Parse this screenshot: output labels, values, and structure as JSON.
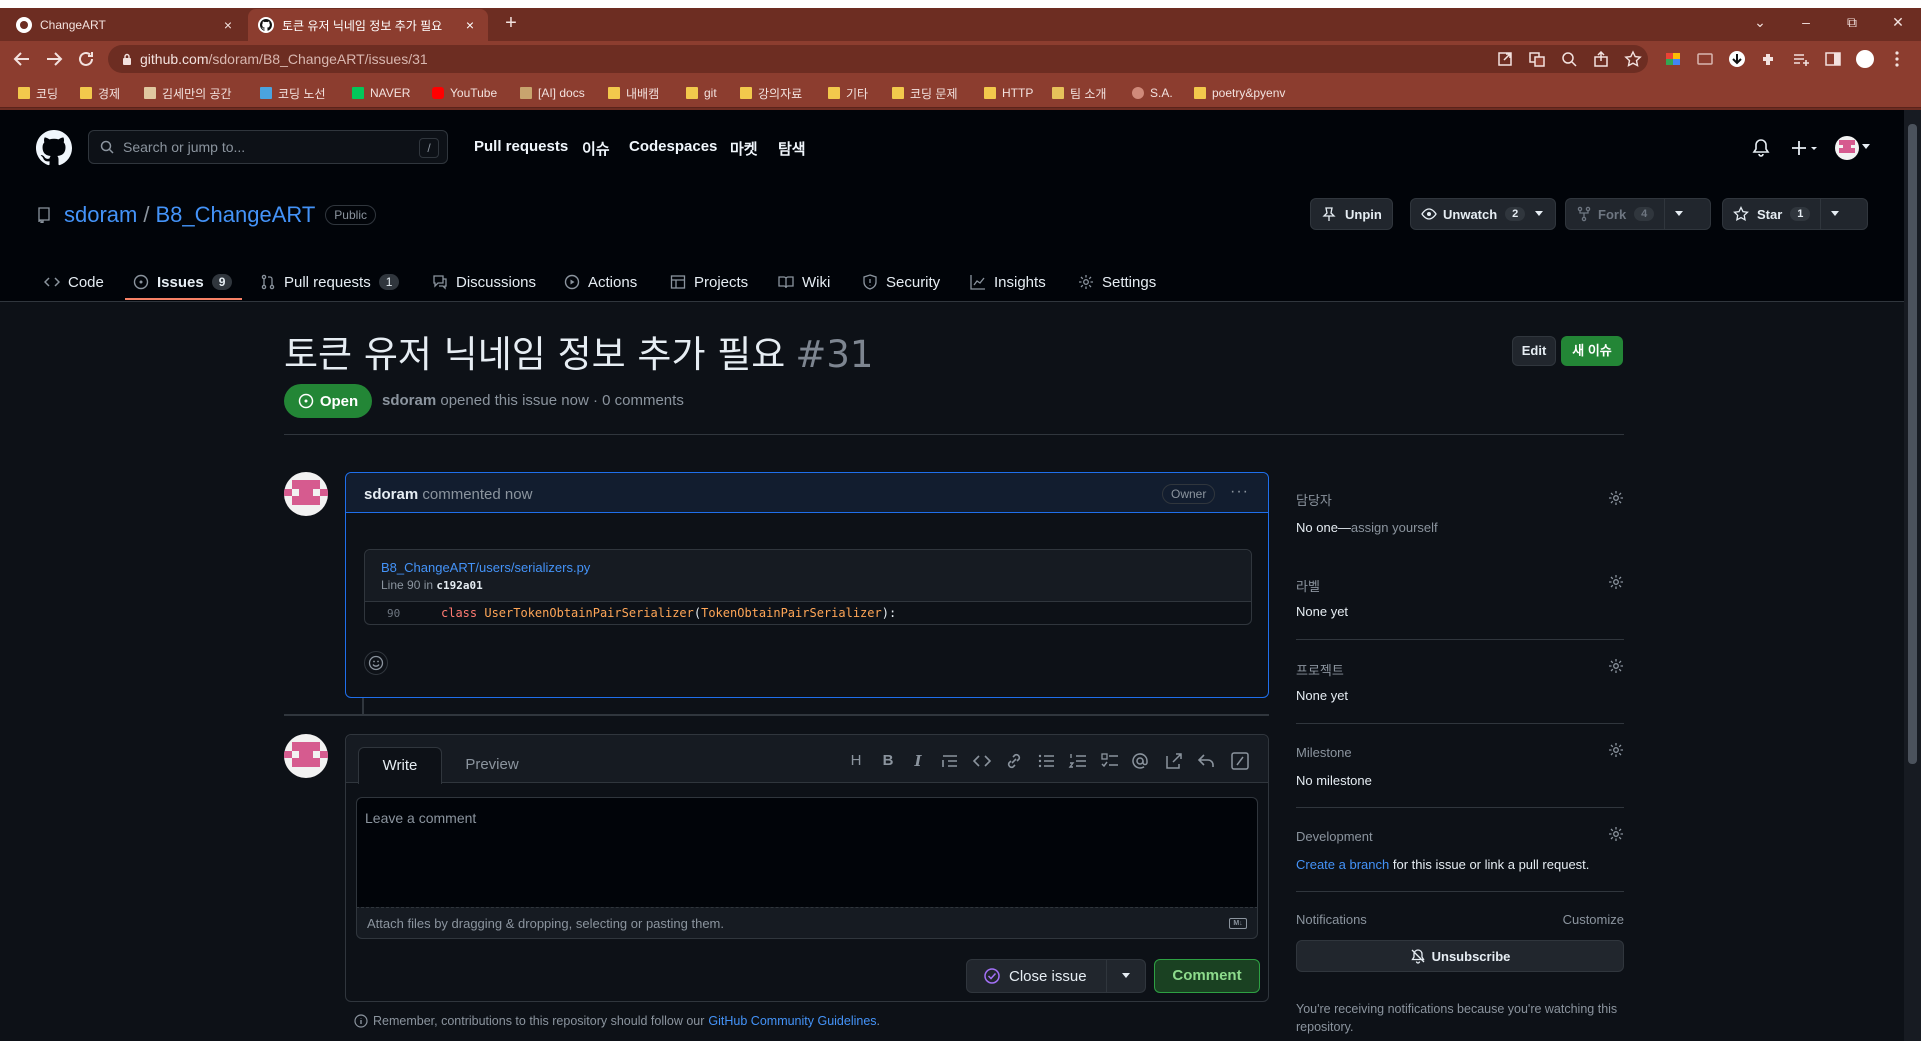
{
  "browser": {
    "tabs": [
      {
        "label": "ChangeART",
        "close": "×"
      },
      {
        "label": "토큰 유저 닉네임 정보 추가 필요",
        "close": "×"
      }
    ],
    "new_tab": "+",
    "window_controls": [
      "⌄",
      "–",
      "⧉",
      "✕"
    ],
    "url_host": "github.com",
    "url_path": "/sdoram/B8_ChangeART/issues/31",
    "bookmarks": [
      {
        "label": "코딩",
        "color": "#f2c94c"
      },
      {
        "label": "경제",
        "color": "#f2c94c"
      },
      {
        "label": "김세만의 공간",
        "color": "#e0c8a0"
      },
      {
        "label": "코딩 노선",
        "color": "#4aa3df"
      },
      {
        "label": "NAVER",
        "color": "#03c75a"
      },
      {
        "label": "YouTube",
        "color": "#ff0000"
      },
      {
        "label": "[AI] docs",
        "color": "#c8a46e"
      },
      {
        "label": "내배캠",
        "color": "#f2c94c"
      },
      {
        "label": "git",
        "color": "#f2c94c"
      },
      {
        "label": "강의자료",
        "color": "#f2c94c"
      },
      {
        "label": "기타",
        "color": "#f2c94c"
      },
      {
        "label": "코딩 문제",
        "color": "#f2c94c"
      },
      {
        "label": "HTTP",
        "color": "#f2c94c"
      },
      {
        "label": "팀 소개",
        "color": "#e6c15a"
      },
      {
        "label": "S.A.",
        "color": "#d08a7a"
      },
      {
        "label": "poetry&pyenv",
        "color": "#f2c94c"
      }
    ]
  },
  "github": {
    "search_placeholder": "Search or jump to...",
    "search_key": "/",
    "nav": [
      "Pull requests",
      "이슈",
      "Codespaces",
      "마켓",
      "탐색"
    ]
  },
  "repo": {
    "owner": "sdoram",
    "name": "B8_ChangeART",
    "visibility": "Public",
    "buttons": {
      "unpin": "Unpin",
      "unwatch": "Unwatch",
      "unwatch_count": "2",
      "fork": "Fork",
      "fork_count": "4",
      "star": "Star",
      "star_count": "1"
    },
    "tabs": [
      {
        "label": "Code"
      },
      {
        "label": "Issues",
        "count": "9"
      },
      {
        "label": "Pull requests",
        "count": "1"
      },
      {
        "label": "Discussions"
      },
      {
        "label": "Actions"
      },
      {
        "label": "Projects"
      },
      {
        "label": "Wiki"
      },
      {
        "label": "Security"
      },
      {
        "label": "Insights"
      },
      {
        "label": "Settings"
      }
    ],
    "selected_tab": "Issues"
  },
  "issue": {
    "title": "토큰 유저 닉네임 정보 추가 필요",
    "number": "#31",
    "edit_label": "Edit",
    "new_label": "새 이슈",
    "state": "Open",
    "author": "sdoram",
    "meta_rest": "opened this issue now · 0 comments"
  },
  "comment": {
    "author": "sdoram",
    "action": "commented now",
    "badge": "Owner",
    "kebab": "···",
    "code_path": "B8_ChangeART/users/serializers.py",
    "code_line_prefix": "Line 90 in",
    "code_commit": "c192a01",
    "code_line_number": "90",
    "code_keyword": "class",
    "code_class": "UserTokenObtainPairSerializer",
    "code_base": "TokenObtainPairSerializer",
    "code_open": "(",
    "code_close": "):"
  },
  "composer": {
    "tab_write": "Write",
    "tab_preview": "Preview",
    "placeholder": "Leave a comment",
    "attach_text": "Attach files by dragging & dropping, selecting or pasting them.",
    "md_badge": "M↓",
    "close_issue": "Close issue",
    "comment": "Comment",
    "guidelines_prefix": "Remember, contributions to this repository should follow our",
    "guidelines_link": "GitHub Community Guidelines",
    "guidelines_suffix": "."
  },
  "sidebar": {
    "assignees": {
      "title": "담당자",
      "value_strong": "No one—",
      "value_muted": "assign yourself"
    },
    "labels": {
      "title": "라벨",
      "value": "None yet"
    },
    "projects": {
      "title": "프로젝트",
      "value": "None yet"
    },
    "milestone": {
      "title": "Milestone",
      "value": "No milestone"
    },
    "development": {
      "title": "Development",
      "link": "Create a branch",
      "rest": "for this issue or link a pull request."
    },
    "notifications": {
      "title": "Notifications",
      "customize": "Customize",
      "button": "Unsubscribe",
      "note": "You're receiving notifications because you're watching this repository."
    }
  },
  "colors": {
    "page_bg": "#0d1117",
    "header_bg": "#010409",
    "accent_green": "#238636",
    "link_blue": "#4493f8",
    "tab_underline": "#f78166",
    "browser_frame": "#8c3d2f"
  }
}
